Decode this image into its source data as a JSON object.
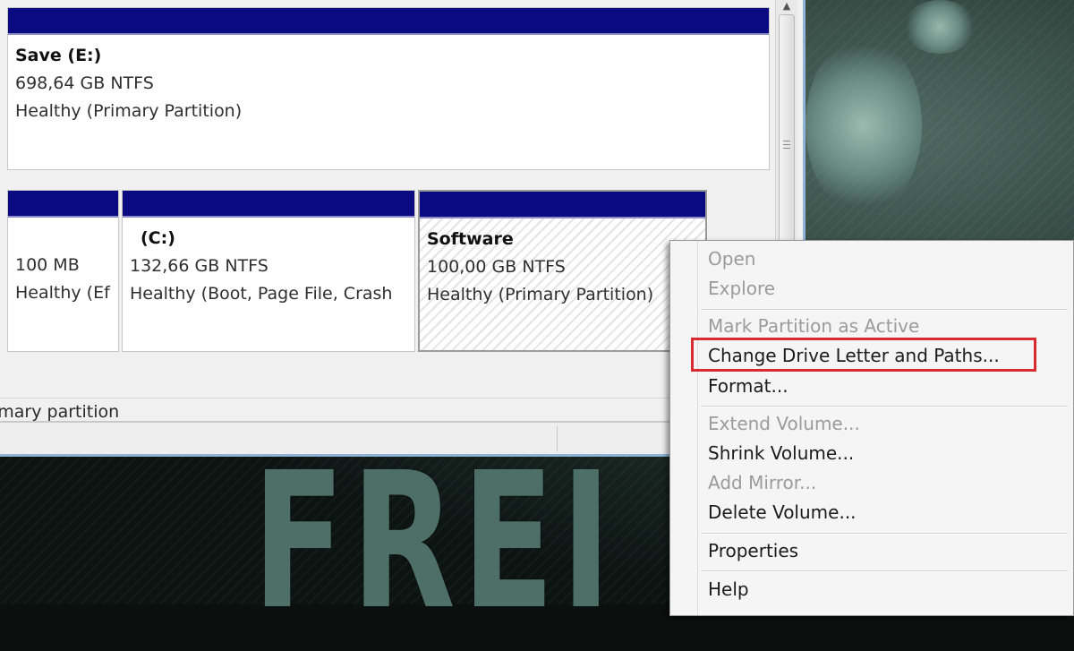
{
  "volumes": {
    "save": {
      "name": "Save  (E:)",
      "size": "698,64 GB NTFS",
      "status": "Healthy (Primary Partition)"
    },
    "system_reserved": {
      "size": "100 MB",
      "status": "Healthy (Ef"
    },
    "c_drive": {
      "name": "(C:)",
      "size": "132,66 GB NTFS",
      "status": "Healthy (Boot, Page File, Crash"
    },
    "software": {
      "name": "Software",
      "size": "100,00 GB NTFS",
      "status": "Healthy (Primary Partition)"
    }
  },
  "legend": {
    "primary_partition": "imary partition"
  },
  "context_menu": {
    "items": [
      {
        "label": "Open",
        "enabled": false
      },
      {
        "label": "Explore",
        "enabled": false
      },
      {
        "label": "Mark Partition as Active",
        "enabled": false
      },
      {
        "label": "Change Drive Letter and Paths...",
        "enabled": true,
        "highlighted": true
      },
      {
        "label": "Format...",
        "enabled": true
      },
      {
        "label": "Extend Volume...",
        "enabled": false
      },
      {
        "label": "Shrink Volume...",
        "enabled": true
      },
      {
        "label": "Add Mirror...",
        "enabled": false
      },
      {
        "label": "Delete Volume...",
        "enabled": true
      },
      {
        "label": "Properties",
        "enabled": true
      },
      {
        "label": "Help",
        "enabled": true
      }
    ]
  },
  "wallpaper": {
    "text": "FREI"
  },
  "colors": {
    "partition_header": "#0a0a82",
    "highlight_border": "#d92a30",
    "disabled_text": "#9b9b9b"
  }
}
